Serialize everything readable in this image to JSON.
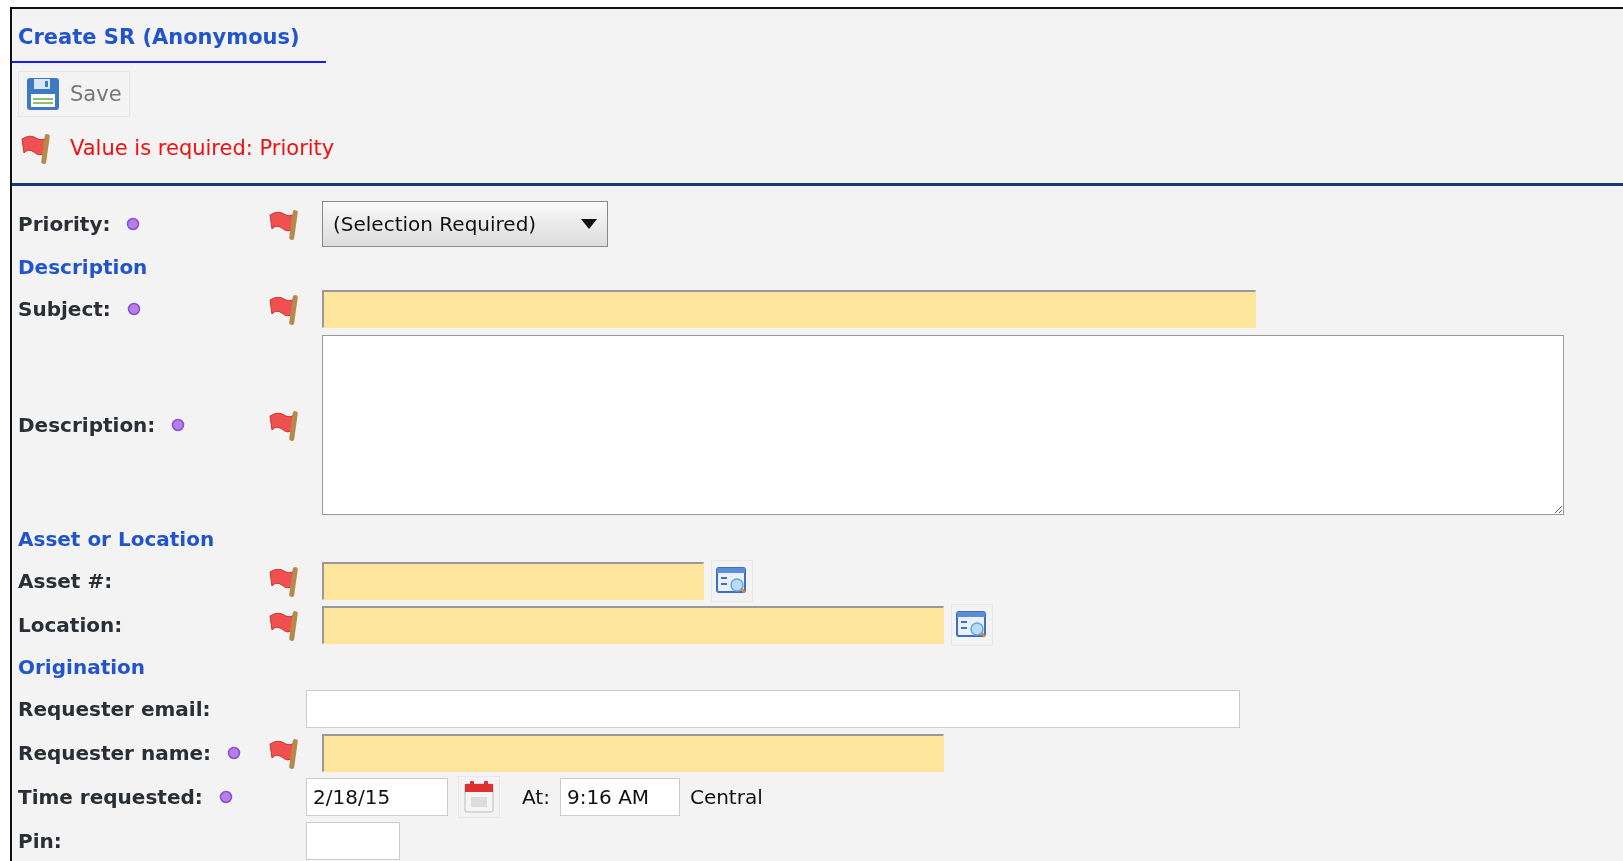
{
  "title": "Create SR (Anonymous)",
  "toolbar": {
    "save_label": "Save"
  },
  "error": {
    "message": "Value is required: Priority"
  },
  "form": [
    {
      "kind": "select",
      "label": "Priority:",
      "required": true,
      "flagged": true,
      "value": "(Selection Required)"
    },
    {
      "kind": "section",
      "label": "Description"
    },
    {
      "kind": "text",
      "label": "Subject:",
      "required": true,
      "flagged": true
    },
    {
      "kind": "textarea",
      "label": "Description:",
      "required": true,
      "flagged": true
    },
    {
      "kind": "section",
      "label": "Asset or Location"
    },
    {
      "kind": "lookup",
      "label": "Asset #:",
      "required": false,
      "flagged": true
    },
    {
      "kind": "lookup",
      "label": "Location:",
      "required": false,
      "flagged": true
    },
    {
      "kind": "section",
      "label": "Origination"
    },
    {
      "kind": "text",
      "label": "Requester email:",
      "required": false,
      "flagged": false
    },
    {
      "kind": "text",
      "label": "Requester name:",
      "required": true,
      "flagged": true
    },
    {
      "kind": "datetime",
      "label": "Time requested:",
      "required": true,
      "flagged": false,
      "date": "2/18/15",
      "at_label": "At:",
      "time": "9:16 AM",
      "zone": "Central"
    },
    {
      "kind": "text",
      "label": "Pin:",
      "required": false,
      "flagged": false
    }
  ]
}
